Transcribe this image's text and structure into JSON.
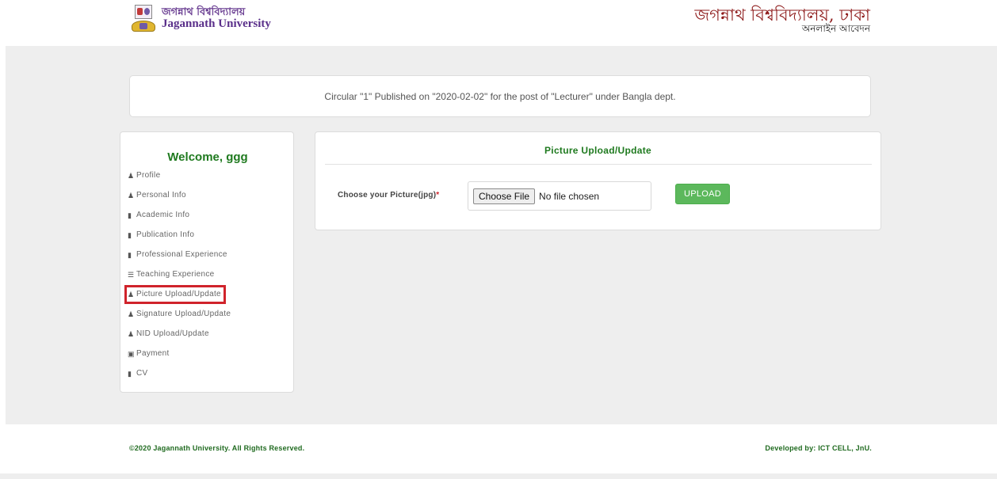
{
  "header": {
    "logo_bn": "জগন্নাথ বিশ্ববিদ্যালয়",
    "logo_en": "Jagannath University",
    "title_bn": "জগন্নাথ বিশ্ববিদ্যালয়, ঢাকা",
    "subtitle_bn": "অনলাইন আবেদন"
  },
  "circular": {
    "text": "Circular \"1\" Published on \"2020-02-02\" for the post of \"Lecturer\" under Bangla dept."
  },
  "sidebar": {
    "welcome": "Welcome, ggg",
    "items": [
      {
        "icon": "user-icon",
        "label": "Profile"
      },
      {
        "icon": "user-icon",
        "label": "Personal Info"
      },
      {
        "icon": "book-icon",
        "label": "Academic Info"
      },
      {
        "icon": "book-icon",
        "label": "Publication Info"
      },
      {
        "icon": "book-icon",
        "label": "Professional Experience"
      },
      {
        "icon": "list-icon",
        "label": "Teaching Experience"
      },
      {
        "icon": "user-icon",
        "label": "Picture Upload/Update",
        "active": true
      },
      {
        "icon": "user-icon",
        "label": "Signature Upload/Update"
      },
      {
        "icon": "user-icon",
        "label": "NID Upload/Update"
      },
      {
        "icon": "money-icon",
        "label": "Payment"
      },
      {
        "icon": "book-icon",
        "label": "CV"
      }
    ]
  },
  "panel": {
    "title": "Picture Upload/Update",
    "field_label": "Choose your Picture(jpg)",
    "required_mark": "*",
    "choose_file_label": "Choose File",
    "no_file_text": "No file chosen",
    "upload_label": "UPLOAD"
  },
  "footer": {
    "copyright": "©2020 Jagannath University. All Rights Reserved.",
    "developer": "Developed by: ICT CELL, JnU."
  },
  "colors": {
    "accent_green": "#1f7a1f",
    "upload_button": "#5cb85c",
    "highlight_red": "#d0232b",
    "header_title": "#8e1b1b"
  }
}
